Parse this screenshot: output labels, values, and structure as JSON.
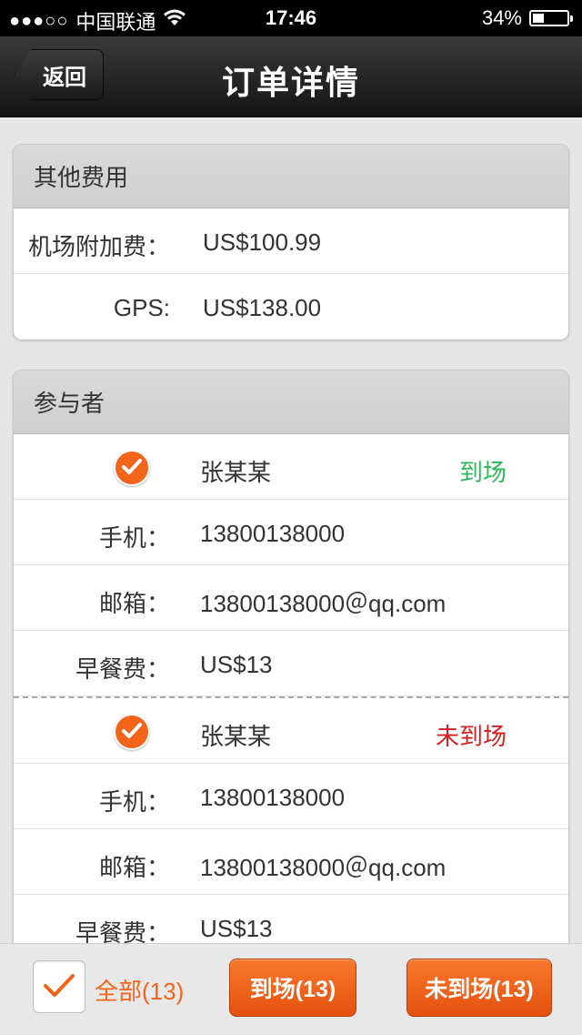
{
  "status_bar": {
    "signal": "●●●○○",
    "carrier": "中国联通",
    "time": "17:46",
    "battery": "34%",
    "battery_level": 0.34
  },
  "nav": {
    "back_label": "返回",
    "title": "订单详情"
  },
  "other_fees": {
    "header": "其他费用",
    "rows": [
      {
        "label": "机场附加费：",
        "value": "US$100.99"
      },
      {
        "label": "GPS:",
        "value": "US$138.00"
      }
    ]
  },
  "participants": {
    "header": "参与者",
    "items": [
      {
        "name": "张某某",
        "status": "到场",
        "phone_label": "手机：",
        "phone": "13800138000",
        "email_label": "邮箱：",
        "email": "13800138000＠qq.com",
        "breakfast_label": "早餐费：",
        "breakfast": "US$13"
      },
      {
        "name": "张某某",
        "status": "未到场",
        "phone_label": "手机：",
        "phone": "13800138000",
        "email_label": "邮箱：",
        "email": "13800138000＠qq.com",
        "breakfast_label": "早餐费：",
        "breakfast": "US$13"
      }
    ]
  },
  "toolbar": {
    "select_all_label": "全部(13)",
    "arrived_button": "到场(13)",
    "absent_button": "未到场(13)"
  },
  "colors": {
    "accent": "#f2641a",
    "arrived": "#2db85a",
    "absent": "#d32020"
  }
}
